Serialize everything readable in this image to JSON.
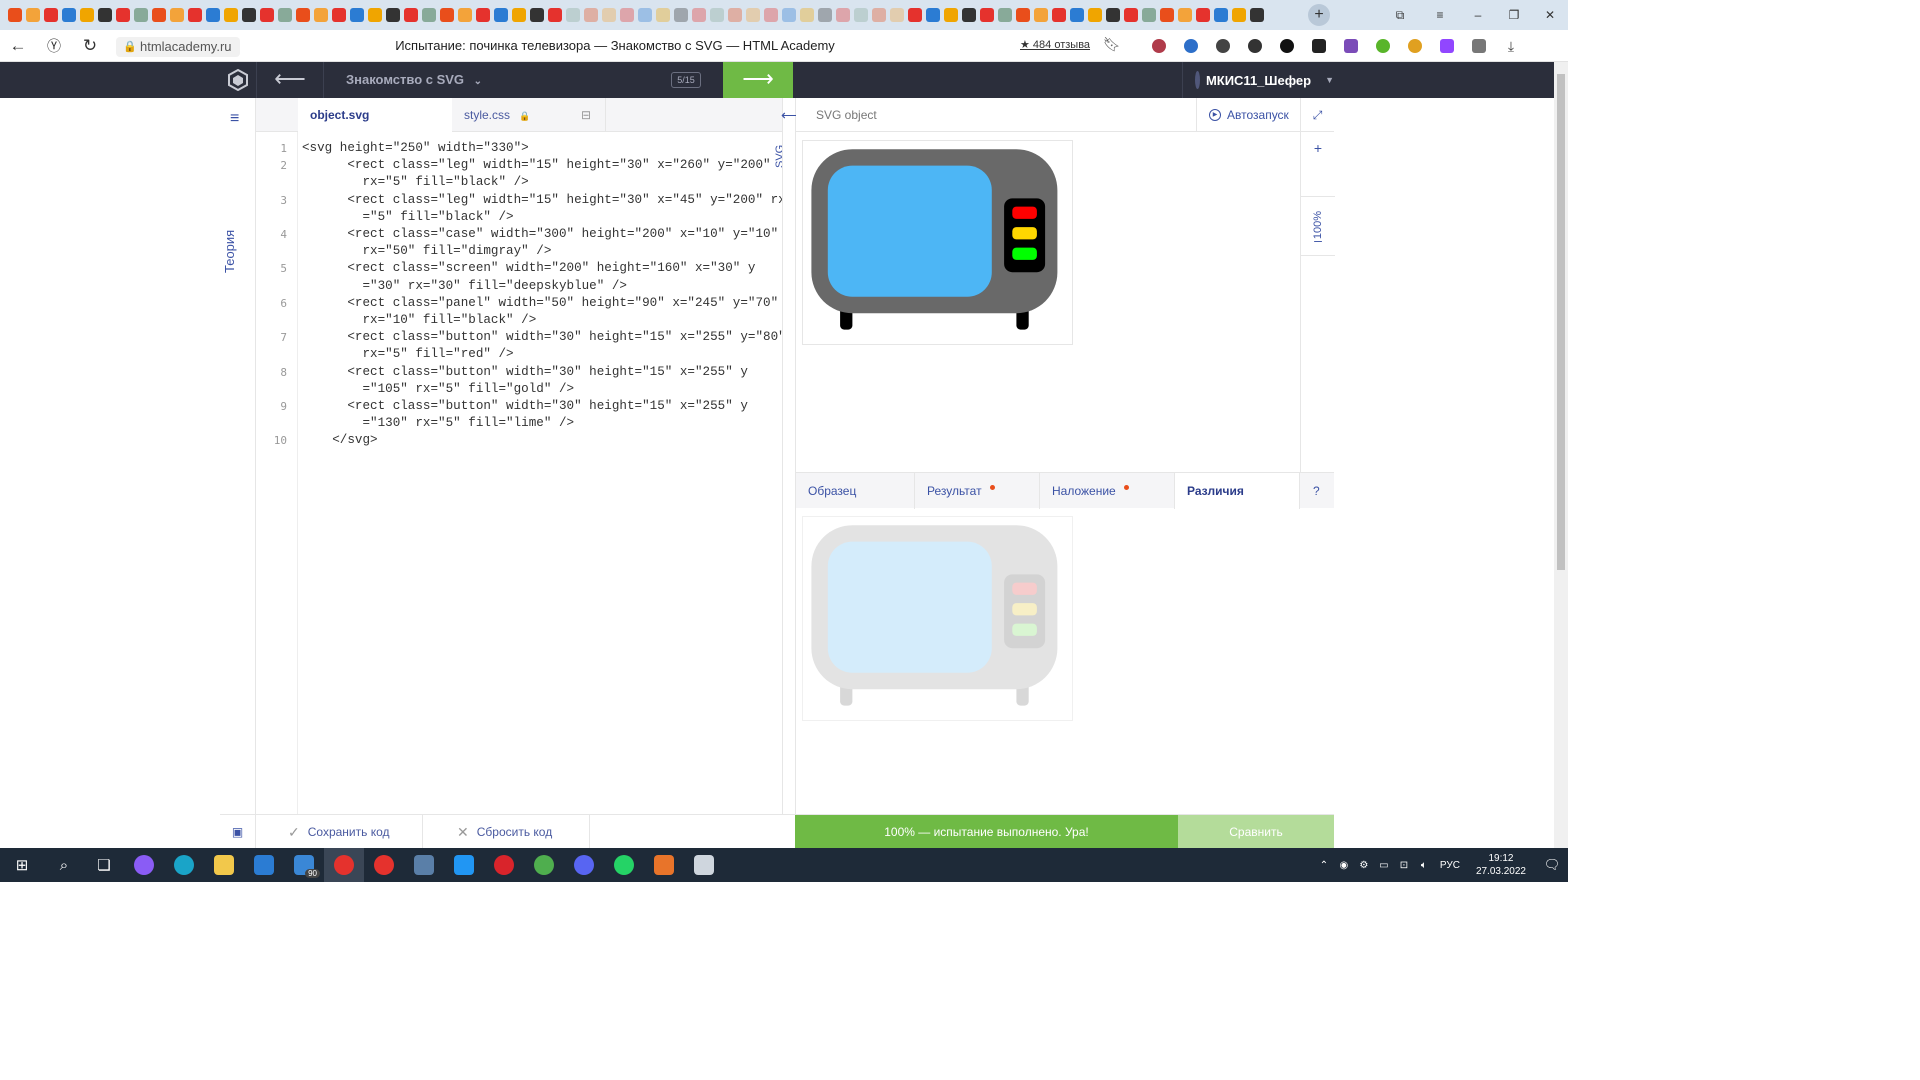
{
  "browser": {
    "url": "htmlacademy.ru",
    "page_title": "Испытание: починка телевизора — Знакомство с SVG — HTML Academy",
    "reviews": "★ 484 отзыва"
  },
  "topnav": {
    "back_arrow": "⟵",
    "course": "Знакомство с SVG",
    "progress": "5/15",
    "next_arrow": "⟶",
    "user_name": "МКИС11_Шефер"
  },
  "sidebar": {
    "theory_label": "Теория"
  },
  "editor": {
    "tabs": [
      {
        "label": "object.svg",
        "active": true
      },
      {
        "label": "style.css",
        "active": false
      }
    ],
    "vertical_label": "SVG",
    "line_numbers": [
      "1",
      "2",
      "3",
      "4",
      "5",
      "6",
      "7",
      "8",
      "9",
      "10"
    ],
    "code_lines": [
      "<svg height=\"250\" width=\"330\">",
      "      <rect class=\"leg\" width=\"15\" height=\"30\" x=\"260\" y=\"200\"",
      "        rx=\"5\" fill=\"black\" />",
      "      <rect class=\"leg\" width=\"15\" height=\"30\" x=\"45\" y=\"200\" rx",
      "        =\"5\" fill=\"black\" />",
      "      <rect class=\"case\" width=\"300\" height=\"200\" x=\"10\" y=\"10\"",
      "        rx=\"50\" fill=\"dimgray\" />",
      "      <rect class=\"screen\" width=\"200\" height=\"160\" x=\"30\" y",
      "        =\"30\" rx=\"30\" fill=\"deepskyblue\" />",
      "      <rect class=\"panel\" width=\"50\" height=\"90\" x=\"245\" y=\"70\"",
      "        rx=\"10\" fill=\"black\" />",
      "      <rect class=\"button\" width=\"30\" height=\"15\" x=\"255\" y=\"80\"",
      "        rx=\"5\" fill=\"red\" />",
      "      <rect class=\"button\" width=\"30\" height=\"15\" x=\"255\" y",
      "        =\"105\" rx=\"5\" fill=\"gold\" />",
      "      <rect class=\"button\" width=\"30\" height=\"15\" x=\"255\" y",
      "        =\"130\" rx=\"5\" fill=\"lime\" />",
      "    </svg>"
    ]
  },
  "preview": {
    "title": "SVG object",
    "autorun": "Автозапуск",
    "zoom_plus": "+",
    "zoom_level": "100%",
    "zoom_minus": "–"
  },
  "compare_tabs": [
    {
      "label": "Образец",
      "dot": false,
      "active": false
    },
    {
      "label": "Результат",
      "dot": true,
      "active": false
    },
    {
      "label": "Наложение",
      "dot": true,
      "active": false
    },
    {
      "label": "Различия",
      "dot": false,
      "active": true
    },
    {
      "label": "?",
      "dot": false,
      "active": false
    }
  ],
  "footer": {
    "save": "Сохранить код",
    "reset": "Сбросить код",
    "success": "100% — испытание выполнено. Ура!",
    "compare": "Сравнить"
  },
  "taskbar": {
    "mail_badge": "90",
    "lang": "РУС",
    "time": "19:12",
    "date": "27.03.2022"
  },
  "colors": {
    "nav_bg": "#2b2e3b",
    "accent_green": "#6fba45",
    "link_blue": "#3b52a5",
    "tv_case": "#696969",
    "tv_screen": "#4db6f5"
  }
}
